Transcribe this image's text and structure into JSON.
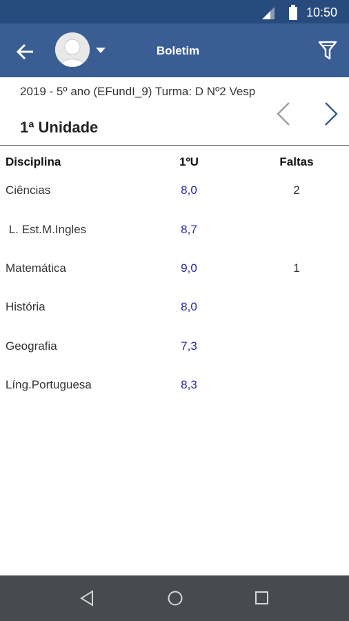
{
  "status": {
    "time": "10:50"
  },
  "app_bar": {
    "title": "Boletim"
  },
  "info": {
    "class_line": "2019 - 5º ano (EFundI_9) Turma: D Nº2 Vesp",
    "unit": "1ª Unidade"
  },
  "table": {
    "headers": {
      "discipline": "Disciplina",
      "grade": "1ºU",
      "absences": "Faltas"
    },
    "rows": [
      {
        "discipline": "Ciências",
        "grade": "8,0",
        "absences": "2"
      },
      {
        "discipline": " L. Est.M.Ingles",
        "grade": "8,7",
        "absences": ""
      },
      {
        "discipline": "Matemática",
        "grade": "9,0",
        "absences": "1"
      },
      {
        "discipline": "História",
        "grade": "8,0",
        "absences": ""
      },
      {
        "discipline": "Geografia",
        "grade": "7,3",
        "absences": ""
      },
      {
        "discipline": "Líng.Portuguesa",
        "grade": "8,3",
        "absences": ""
      }
    ]
  },
  "icons": {
    "back": "arrow-back-icon",
    "filter": "filter-icon",
    "prev": "chevron-left-icon",
    "next": "chevron-right-icon"
  },
  "colors": {
    "app_bar": "#3a5e94",
    "status_bar": "#284b7d",
    "grade": "#2626a8",
    "nav_bar": "#474b4f"
  }
}
